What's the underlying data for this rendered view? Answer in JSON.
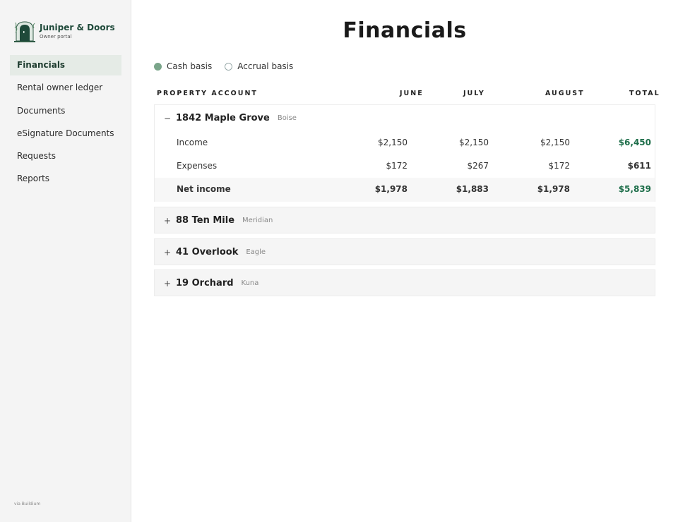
{
  "brand": {
    "name": "Juniper & Doors",
    "subtitle": "Owner portal"
  },
  "nav": [
    {
      "label": "Financials",
      "active": true
    },
    {
      "label": "Rental owner ledger",
      "active": false
    },
    {
      "label": "Documents",
      "active": false
    },
    {
      "label": "eSignature Documents",
      "active": false
    },
    {
      "label": "Requests",
      "active": false
    },
    {
      "label": "Reports",
      "active": false
    }
  ],
  "footer": "via Buildium",
  "page": {
    "title": "Financials"
  },
  "basis": {
    "cash": "Cash basis",
    "accrual": "Accrual basis",
    "selected": "cash"
  },
  "columns": {
    "account": "PROPERTY ACCOUNT",
    "june": "JUNE",
    "july": "JULY",
    "august": "AUGUST",
    "total": "TOTAL"
  },
  "properties": [
    {
      "name": "1842 Maple Grove",
      "city": "Boise",
      "expanded": true,
      "toggle": "−",
      "rows": [
        {
          "label": "Income",
          "june": "$2,150",
          "july": "$2,150",
          "august": "$2,150",
          "total": "$6,450"
        },
        {
          "label": "Expenses",
          "june": "$172",
          "july": "$267",
          "august": "$172",
          "total": "$611"
        },
        {
          "label": "Net income",
          "june": "$1,978",
          "july": "$1,883",
          "august": "$1,978",
          "total": "$5,839"
        }
      ]
    },
    {
      "name": "88 Ten Mile",
      "city": "Meridian",
      "expanded": false,
      "toggle": "+"
    },
    {
      "name": "41 Overlook",
      "city": "Eagle",
      "expanded": false,
      "toggle": "+"
    },
    {
      "name": "19 Orchard",
      "city": "Kuna",
      "expanded": false,
      "toggle": "+"
    }
  ],
  "colors": {
    "accent": "#7aa58a",
    "brand": "#1f4a3a",
    "positive": "#1e6e4a"
  }
}
